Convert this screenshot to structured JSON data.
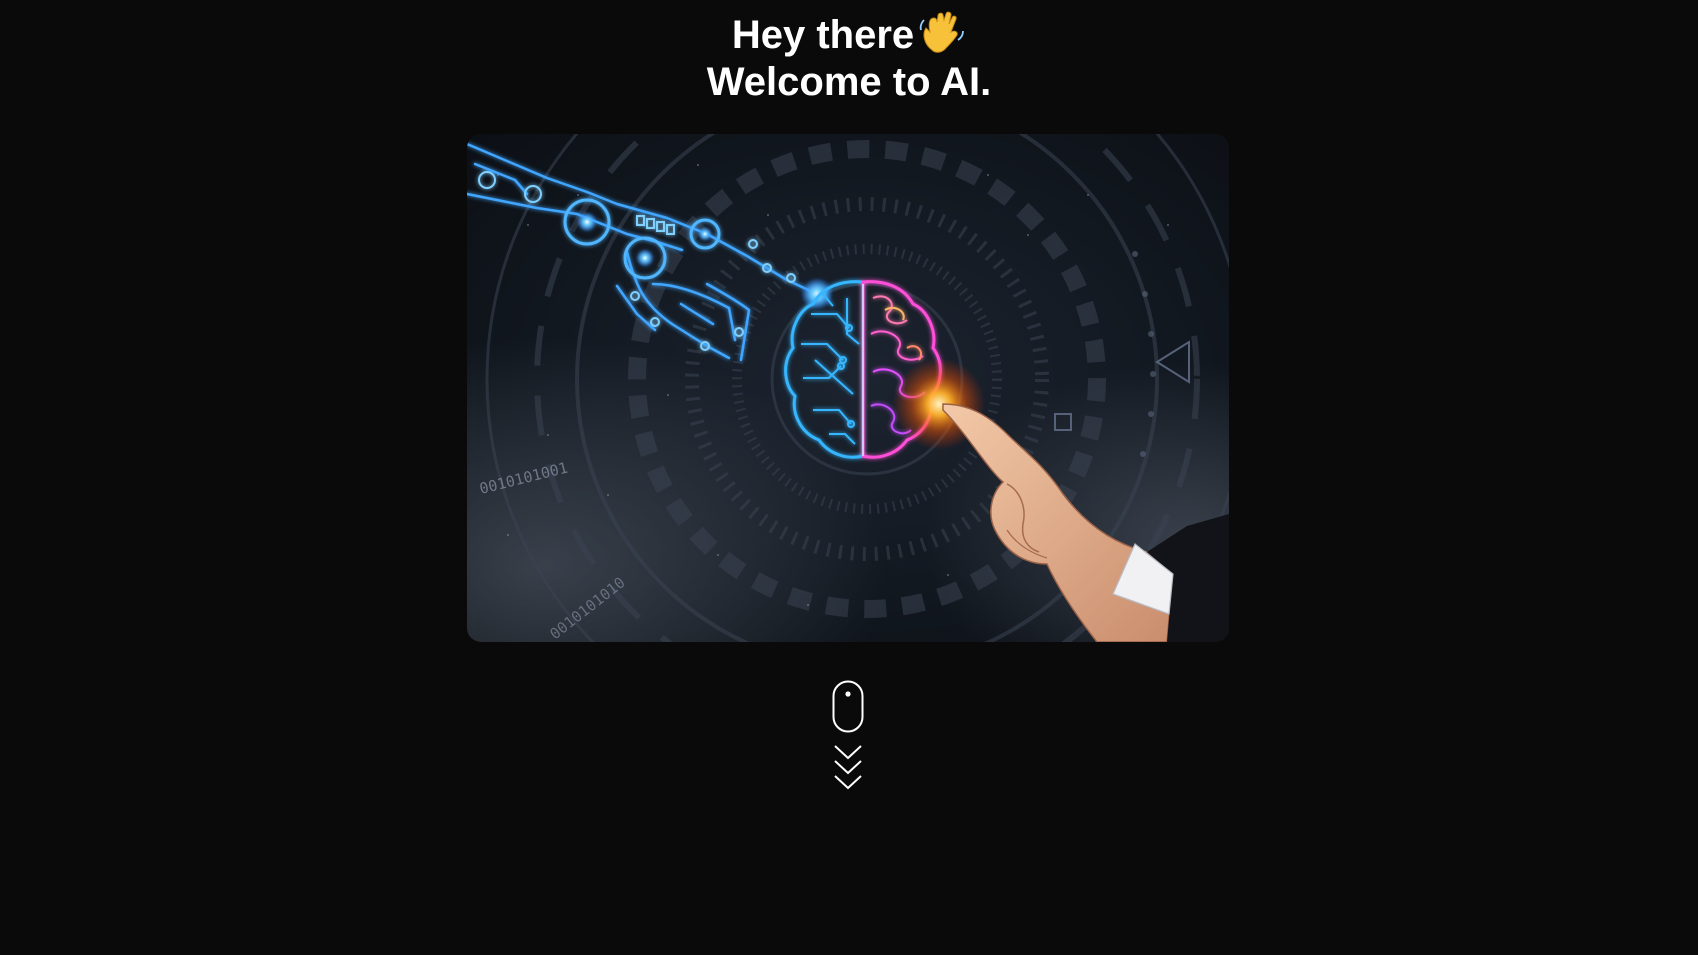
{
  "hero": {
    "greeting": "Hey there",
    "wave_icon": "waving-hand-icon",
    "welcome": "Welcome to AI.",
    "image_subject": "ai-brain-robot-human-hand-image",
    "binary_text_1": "0010101001",
    "binary_text_2": "0010101010"
  },
  "scroll_indicator": {
    "mouse_icon": "mouse-icon",
    "chevrons_icon": "triple-chevron-down-icon"
  },
  "colors": {
    "background": "#0a0a0b",
    "text": "#ffffff",
    "robot_glow": "#2a8cff",
    "brain_left": "#35b6ff",
    "brain_right": "#ff4fd8",
    "spark": "#ff9a1f"
  }
}
